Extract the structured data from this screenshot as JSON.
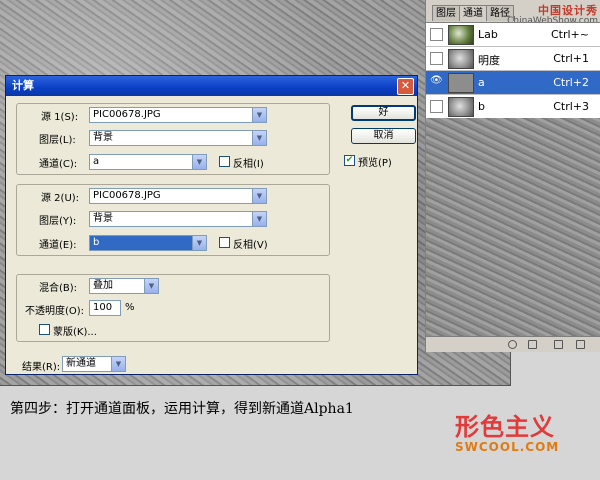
{
  "panel": {
    "tabs": [
      "图层",
      "通道",
      "路径"
    ],
    "watermark": "中国设计秀",
    "watermark_url": "ChinaWebShow.com",
    "channels": [
      {
        "name": "Lab",
        "shortcut": "Ctrl+~",
        "visible": false,
        "selected": false
      },
      {
        "name": "明度",
        "shortcut": "Ctrl+1",
        "visible": false,
        "selected": false
      },
      {
        "name": "a",
        "shortcut": "Ctrl+2",
        "visible": true,
        "selected": true
      },
      {
        "name": "b",
        "shortcut": "Ctrl+3",
        "visible": false,
        "selected": false
      }
    ]
  },
  "dialog": {
    "title": "计算",
    "close": "✕",
    "ok_label": "好",
    "cancel_label": "取消",
    "preview_label": "预览(P)",
    "preview_checked": true,
    "source1": {
      "label": "源 1(S):",
      "file": "PIC00678.JPG",
      "layer_label": "图层(L):",
      "layer": "背景",
      "channel_label": "通道(C):",
      "channel": "a",
      "invert_label": "反相(I)"
    },
    "source2": {
      "label": "源 2(U):",
      "file": "PIC00678.JPG",
      "layer_label": "图层(Y):",
      "layer": "背景",
      "channel_label": "通道(E):",
      "channel": "b",
      "invert_label": "反相(V)"
    },
    "blend": {
      "label": "混合(B):",
      "mode": "叠加",
      "opacity_label": "不透明度(O):",
      "opacity": "100",
      "opacity_unit": "%",
      "mask_label": "蒙版(K)..."
    },
    "result": {
      "label": "结果(R):",
      "value": "新通道"
    }
  },
  "caption": "第四步：打开通道面板，运用计算，得到新通道Alpha1",
  "logo": {
    "text": "形色主义",
    "url": "SWCOOL.COM"
  }
}
